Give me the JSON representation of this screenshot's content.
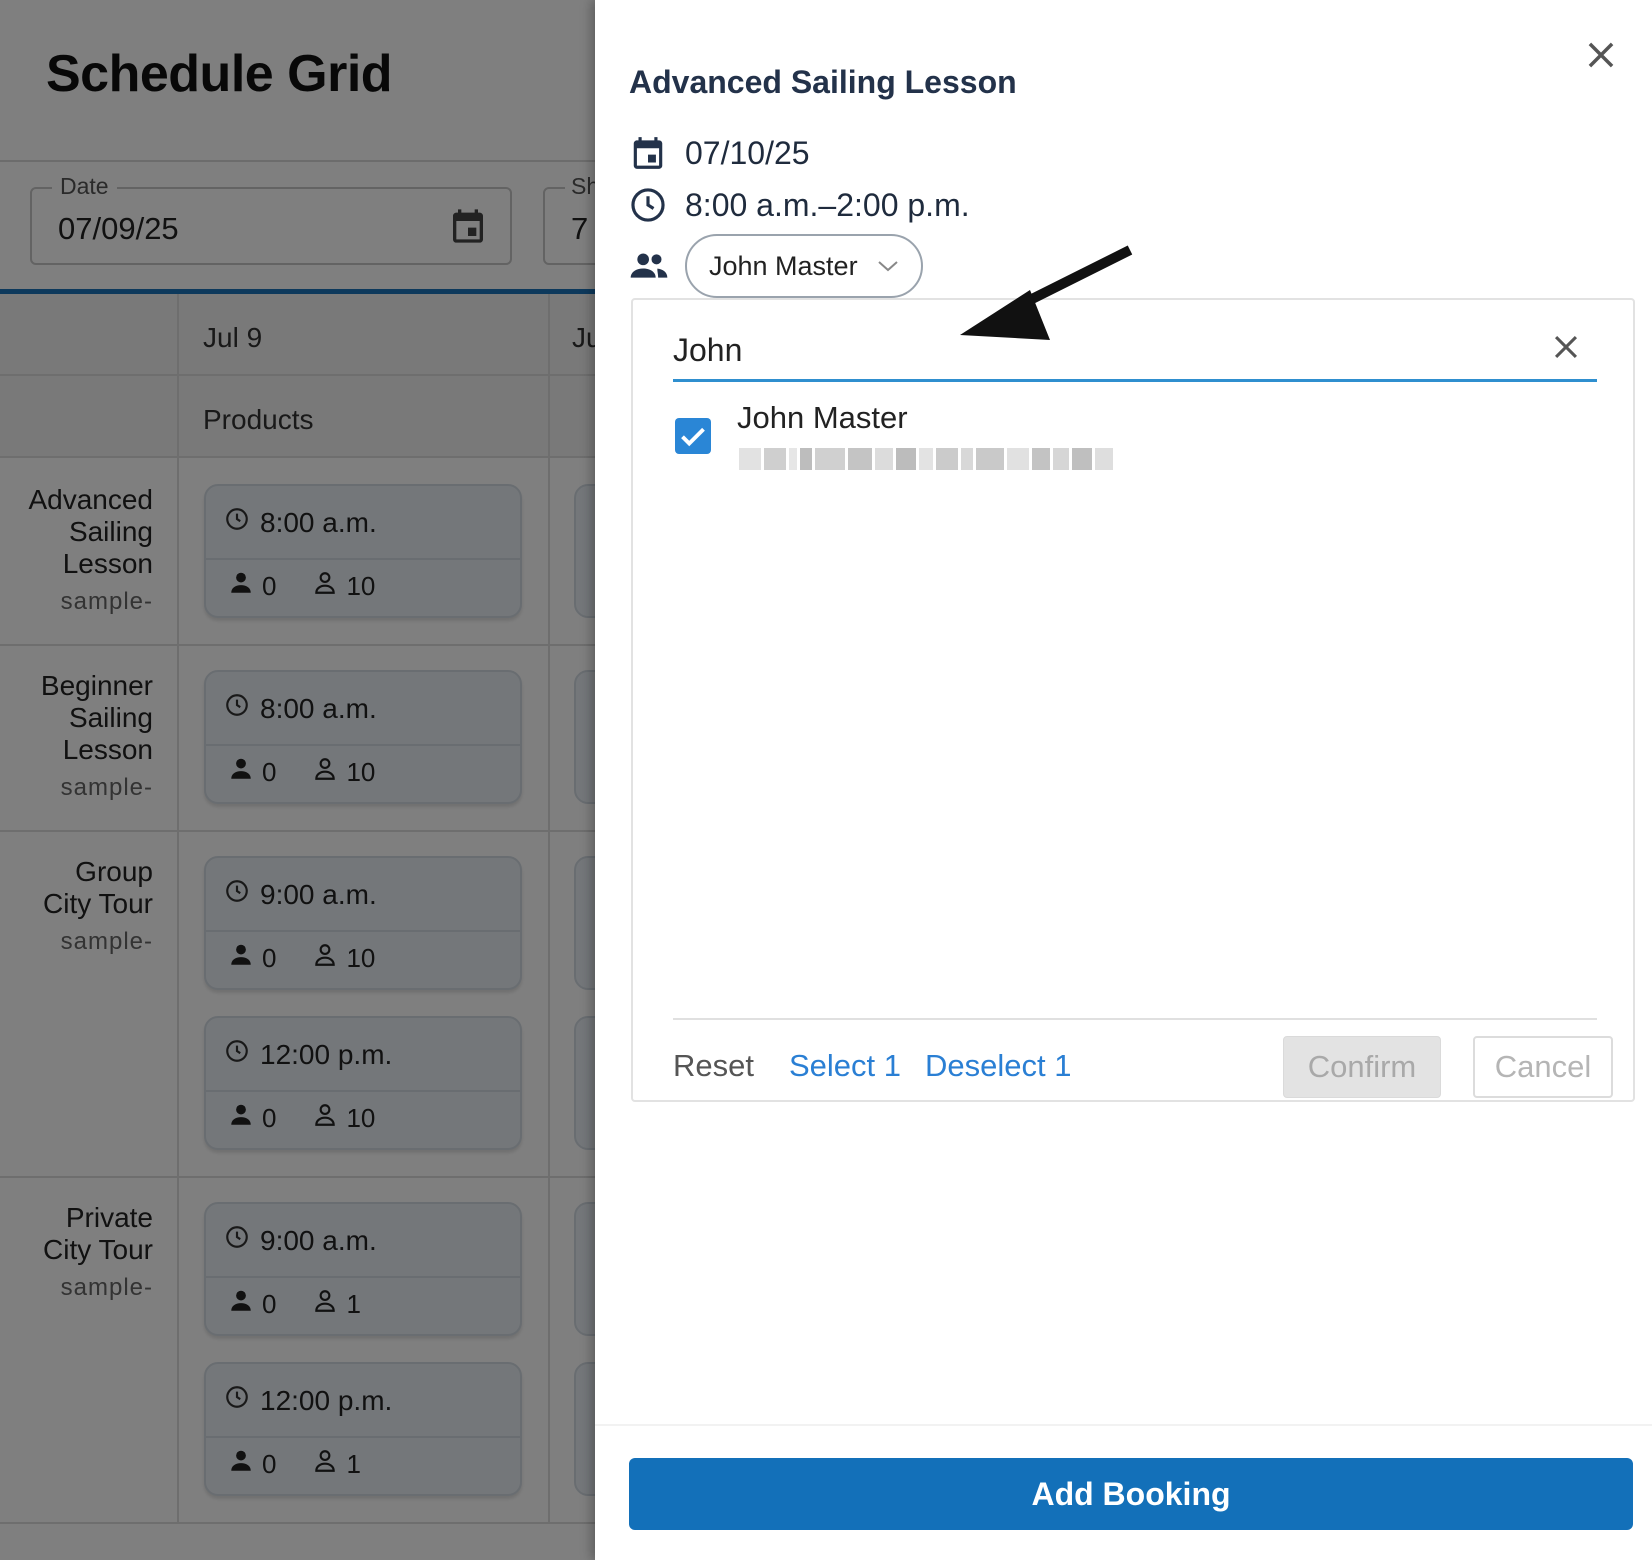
{
  "background": {
    "title": "Schedule Grid",
    "date_field": {
      "label": "Date",
      "value": "07/09/25"
    },
    "shift_field": {
      "label": "Sh",
      "value": "7"
    },
    "columns": {
      "date": "Jul 9",
      "date_next": "Ju",
      "products_header": "Products"
    },
    "products": [
      {
        "name_lines": [
          "Advanced",
          "Sailing",
          "Lesson"
        ],
        "sub": "sample-",
        "slots": [
          {
            "time": "8:00 a.m.",
            "booked": "0",
            "capacity": "10"
          }
        ]
      },
      {
        "name_lines": [
          "Beginner",
          "Sailing",
          "Lesson"
        ],
        "sub": "sample-",
        "slots": [
          {
            "time": "8:00 a.m.",
            "booked": "0",
            "capacity": "10"
          }
        ]
      },
      {
        "name_lines": [
          "Group",
          "City Tour"
        ],
        "sub": "sample-",
        "slots": [
          {
            "time": "9:00 a.m.",
            "booked": "0",
            "capacity": "10"
          },
          {
            "time": "12:00 p.m.",
            "booked": "0",
            "capacity": "10"
          }
        ]
      },
      {
        "name_lines": [
          "Private",
          "City Tour"
        ],
        "sub": "sample-",
        "slots": [
          {
            "time": "9:00 a.m.",
            "booked": "0",
            "capacity": "1"
          },
          {
            "time": "12:00 p.m.",
            "booked": "0",
            "capacity": "1"
          }
        ]
      }
    ]
  },
  "drawer": {
    "title": "Advanced Sailing Lesson",
    "date": "07/10/25",
    "time_range": "8:00 a.m.–2:00 p.m.",
    "staff_chip": "John Master",
    "picker": {
      "search_value": "John",
      "results": [
        {
          "name": "John Master",
          "checked": true
        }
      ],
      "footer": {
        "reset": "Reset",
        "select": "Select 1",
        "deselect": "Deselect 1",
        "confirm": "Confirm",
        "cancel": "Cancel"
      }
    },
    "primary_button": "Add Booking"
  },
  "colors": {
    "accent": "#1370b9",
    "link": "#2a7fd4",
    "checkbox": "#2a86d6",
    "search_underline": "#2f8fcf"
  },
  "icons": [
    "calendar-icon",
    "clock-icon",
    "people-icon",
    "chevron-down-icon",
    "close-icon",
    "check-icon",
    "person-icon",
    "person-outline-icon"
  ]
}
